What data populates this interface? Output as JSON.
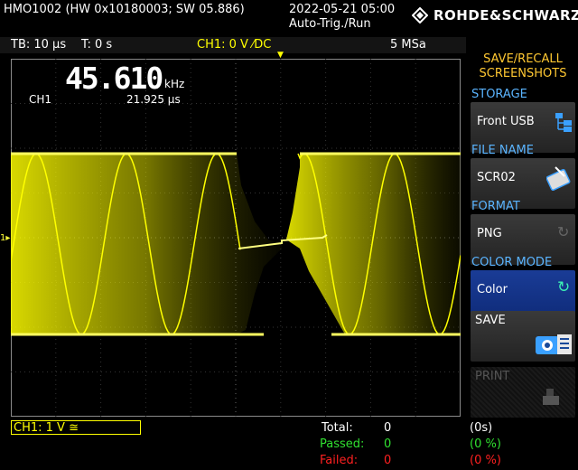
{
  "header": {
    "device": "HMO1002 (HW 0x10180003; SW 05.886)",
    "datetime": "2022-05-21 05:00",
    "trigger_mode": "Auto-Trig./Run",
    "brand": "ROHDE&SCHWARZ"
  },
  "status_bar": {
    "timebase": "TB: 10 µs",
    "trigger_time": "T: 0 s",
    "channel_trigger": "CH1: 0 V ⁄DC",
    "sample_rate": "5 MSa"
  },
  "measure": {
    "frequency_value": "45.610",
    "frequency_unit": "kHz",
    "channel": "CH1",
    "period": "21.925 µs"
  },
  "waveform": {
    "ground_marker": "1"
  },
  "softmenu": {
    "title_line1": "SAVE/RECALL",
    "title_line2": "SCREENSHOTS",
    "storage_label": "STORAGE",
    "storage_value": "Front USB",
    "filename_label": "FILE NAME",
    "filename_value": "SCR02",
    "format_label": "FORMAT",
    "format_value": "PNG",
    "colormode_label": "COLOR MODE",
    "colormode_value": "Color",
    "save_label": "SAVE",
    "print_label": "PRINT"
  },
  "bottom": {
    "channel_setting": "CH1: 1 V ≅",
    "total_label": "Total:",
    "total_value": "0",
    "total_time": "(0s)",
    "passed_label": "Passed:",
    "passed_value": "0",
    "passed_pct": "(0 %)",
    "failed_label": "Failed:",
    "failed_value": "0",
    "failed_pct": "(0 %)"
  },
  "colors": {
    "trace": "#ffff00",
    "menu_title": "#ffc832",
    "section_label": "#5ab4ff",
    "passed": "#30e030",
    "failed": "#ff2020"
  }
}
